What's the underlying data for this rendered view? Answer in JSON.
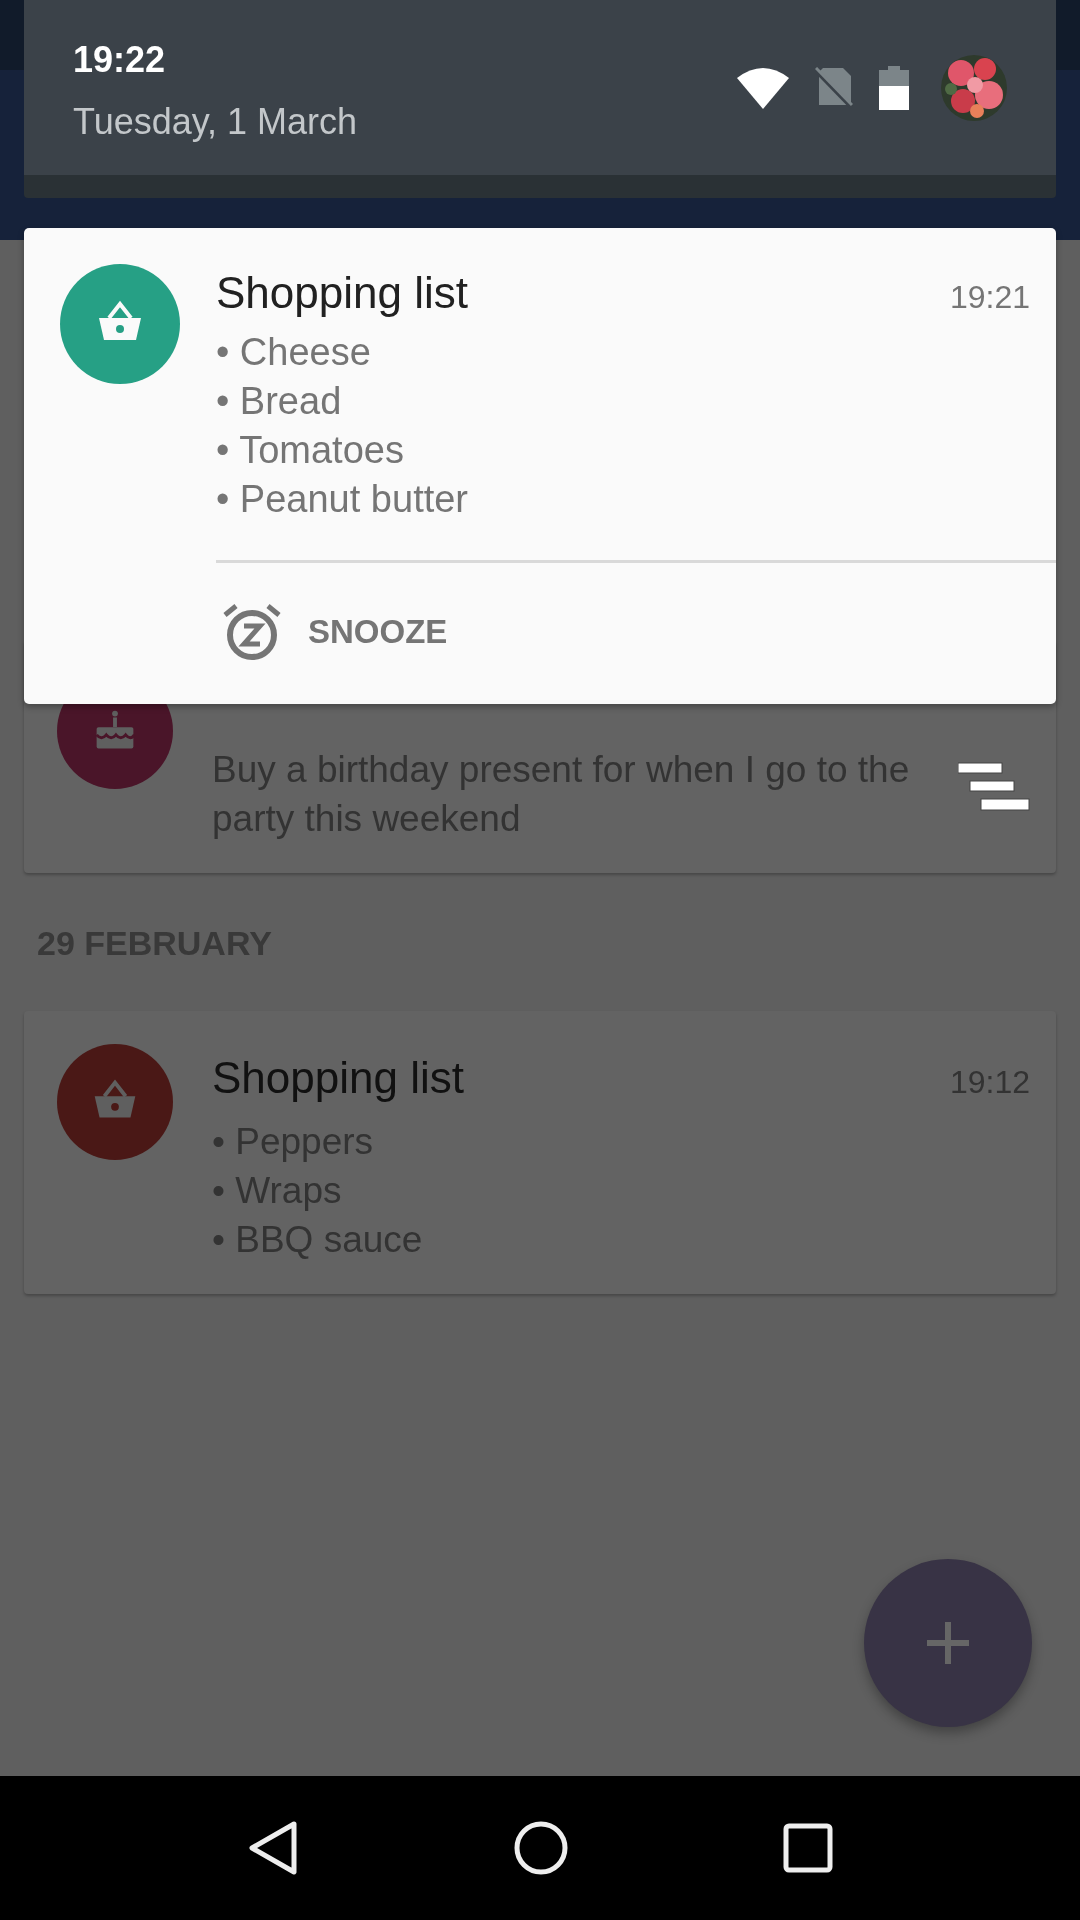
{
  "quick_settings": {
    "time": "19:22",
    "date": "Tuesday, 1 March"
  },
  "notification": {
    "title": "Shopping list",
    "time": "19:21",
    "lines": [
      "• Cheese",
      "• Bread",
      "• Tomatoes",
      "• Peanut butter"
    ],
    "actions": [
      {
        "label": "SNOOZE"
      }
    ]
  },
  "reminders": [
    {
      "kind": "birthday",
      "color": "#4a1529",
      "body": "Buy a birthday present for when I go to the party this weekend"
    }
  ],
  "sections": [
    {
      "heading": "29 FEBRUARY",
      "reminders": [
        {
          "kind": "shopping",
          "color": "#4a1816",
          "title": "Shopping list",
          "time": "19:12",
          "lines": [
            "• Peppers",
            "• Wraps",
            "• BBQ sauce"
          ]
        }
      ]
    }
  ]
}
